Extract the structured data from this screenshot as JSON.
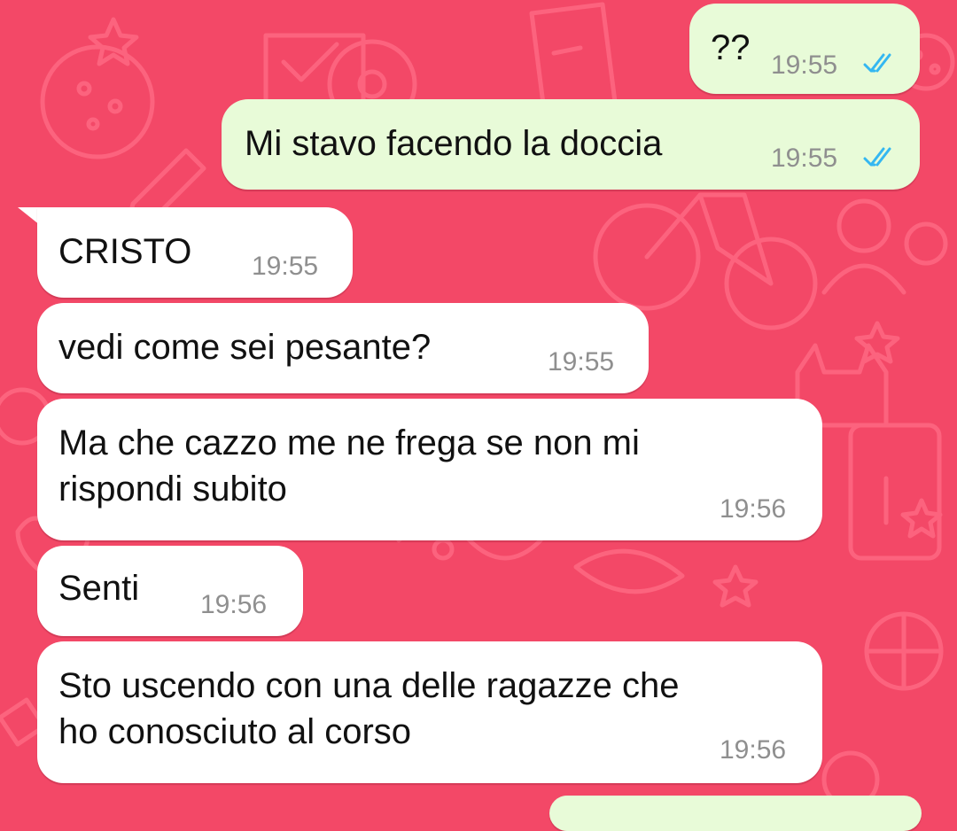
{
  "colors": {
    "background": "#f34867",
    "outgoing_bubble": "#e8fbd8",
    "incoming_bubble": "#ffffff",
    "read_ticks": "#34b7f1",
    "timestamp": "#8f8f8f"
  },
  "messages": [
    {
      "direction": "outgoing",
      "text": "??",
      "time": "19:55",
      "status": "read"
    },
    {
      "direction": "outgoing",
      "text": "Mi stavo facendo la doccia",
      "time": "19:55",
      "status": "read"
    },
    {
      "direction": "incoming",
      "text": "CRISTO",
      "time": "19:55"
    },
    {
      "direction": "incoming",
      "text": "vedi come sei pesante?",
      "time": "19:55"
    },
    {
      "direction": "incoming",
      "text": "Ma che cazzo me ne frega se non mi\nrispondi subito",
      "time": "19:56"
    },
    {
      "direction": "incoming",
      "text": "Senti",
      "time": "19:56"
    },
    {
      "direction": "incoming",
      "text": "Sto uscendo con una delle ragazze che\nho conosciuto al corso",
      "time": "19:56"
    }
  ]
}
